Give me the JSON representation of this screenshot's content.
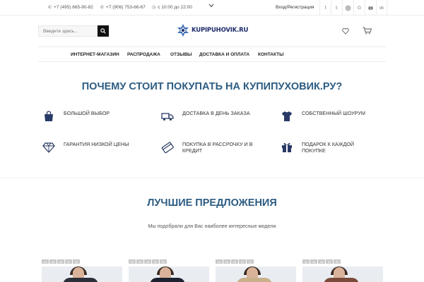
{
  "topbar": {
    "phone1": "+7 (495) 665-90-82",
    "phone2": "+7 (906) 753-66-67",
    "hours": "с 10:00 до 22:00",
    "login": "Вход/Регистрация",
    "socials": [
      "f",
      "t",
      "ig",
      "G",
      "yt",
      "vk"
    ]
  },
  "header": {
    "search_placeholder": "Введите здесь...",
    "logo_text": "KUPIPUHOVIK.RU"
  },
  "nav": {
    "items": [
      "ИНТЕРНЕТ-МАГАЗИН",
      "РАСПРОДАЖА",
      "ОТЗЫВЫ",
      "ДОСТАВКА И ОПЛАТА",
      "КОНТАКТЫ"
    ]
  },
  "why": {
    "title": "ПОЧЕМУ СТОИТ ПОКУПАТЬ НА КУПИПУХОВИК.РУ?",
    "features": [
      {
        "text": "БОЛЬШОЙ ВЫБОР",
        "icon": "shopping-bag-icon"
      },
      {
        "text": "ДОСТАВКА В ДЕНЬ ЗАКАЗА",
        "icon": "truck-icon"
      },
      {
        "text": "СОБСТВЕННЫЙ ШОУРУМ",
        "icon": "shirt-icon"
      },
      {
        "text": "ГАРАНТИЯ НИЗКОЙ ЦЕНЫ",
        "icon": "diamond-icon"
      },
      {
        "text": "ПОКУПКА В РАССРОЧКУ И В КРЕДИТ",
        "icon": "credit-card-icon"
      },
      {
        "text": "ПОДАРОК К КАЖДОЙ ПОКУПКЕ",
        "icon": "gift-icon"
      }
    ]
  },
  "offers": {
    "title": "ЛУЧШИЕ ПРЕДЛОЖЕНИЯ",
    "subtitle": "Мы подобрали для Вас наиболее интересные модели",
    "cards": [
      {
        "sizes": [
          "44",
          "46",
          "48",
          "50",
          "52"
        ],
        "coat_color": "#2b2f3a"
      },
      {
        "sizes": [
          "44",
          "46",
          "48",
          "50",
          "52"
        ],
        "coat_color": "#1d2230"
      },
      {
        "sizes": [
          "44",
          "46",
          "48",
          "50",
          "52"
        ],
        "coat_color": "#c9b08a"
      },
      {
        "sizes": [
          "44",
          "46",
          "48",
          "50",
          "52"
        ],
        "coat_color": "#7a4a3a"
      }
    ]
  },
  "colors": {
    "accent": "#2c5c82",
    "logo": "#1f2d6b",
    "icon": "#2a3a66"
  }
}
